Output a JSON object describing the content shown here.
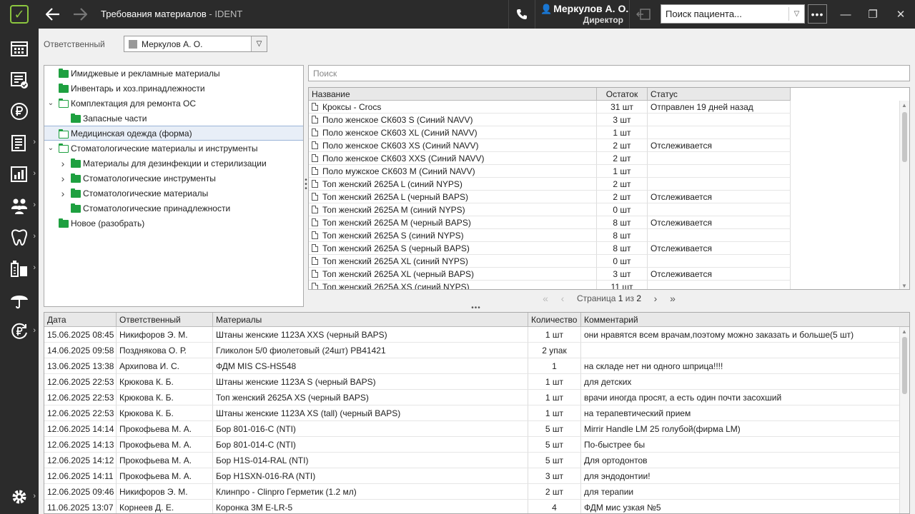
{
  "titlebar": {
    "title": "Требования материалов",
    "subtitle": " - IDENT",
    "user_name": "Меркулов А. О.",
    "user_role": "Директор",
    "patient_search_placeholder": "Поиск пациента..."
  },
  "filter": {
    "label": "Ответственный",
    "value": "Меркулов А. О."
  },
  "tree": [
    {
      "label": "Имиджевые и рекламные материалы",
      "level": 0,
      "expander": "",
      "folder": "closed",
      "selected": false
    },
    {
      "label": "Инвентарь и хоз.принадлежности",
      "level": 0,
      "expander": "",
      "folder": "closed",
      "selected": false
    },
    {
      "label": "Комплектация для ремонта ОС",
      "level": 0,
      "expander": "down",
      "folder": "open",
      "selected": false
    },
    {
      "label": "Запасные части",
      "level": 1,
      "expander": "",
      "folder": "closed",
      "selected": false
    },
    {
      "label": "Медицинская одежда (форма)",
      "level": 0,
      "expander": "",
      "folder": "open",
      "selected": true
    },
    {
      "label": "Стоматологические материалы и инструменты",
      "level": 0,
      "expander": "down",
      "folder": "open",
      "selected": false
    },
    {
      "label": "Материалы для дезинфекции и стерилизации",
      "level": 1,
      "expander": "right",
      "folder": "closed",
      "selected": false
    },
    {
      "label": "Стоматологические инструменты",
      "level": 1,
      "expander": "right",
      "folder": "closed",
      "selected": false
    },
    {
      "label": "Стоматологические материалы",
      "level": 1,
      "expander": "right",
      "folder": "closed",
      "selected": false
    },
    {
      "label": "Стоматологические принадлежности",
      "level": 1,
      "expander": "",
      "folder": "closed",
      "selected": false
    },
    {
      "label": "Новое (разобрать)",
      "level": 0,
      "expander": "",
      "folder": "closed",
      "selected": false
    }
  ],
  "materials": {
    "search_placeholder": "Поиск",
    "columns": {
      "name": "Название",
      "stock": "Остаток",
      "status": "Статус"
    },
    "rows": [
      {
        "name": "Кроксы  -  Crocs",
        "stock": "31 шт",
        "status": "Отправлен 19 дней назад"
      },
      {
        "name": "Поло женское СК603 S (Синий NAVV)",
        "stock": "3 шт",
        "status": ""
      },
      {
        "name": "Поло женское СК603 XL (Синий NAVV)",
        "stock": "1 шт",
        "status": ""
      },
      {
        "name": "Поло женское СК603 XS (Синий NAVV)",
        "stock": "2 шт",
        "status": "Отслеживается"
      },
      {
        "name": "Поло женское СК603 XXS (Синий NAVV)",
        "stock": "2 шт",
        "status": ""
      },
      {
        "name": "Поло мужское СК603 M (Синий NAVV)",
        "stock": "1 шт",
        "status": ""
      },
      {
        "name": "Топ женский 2625A L (синий NYPS)",
        "stock": "2 шт",
        "status": ""
      },
      {
        "name": "Топ женский 2625A L (черный BAPS)",
        "stock": "2 шт",
        "status": "Отслеживается"
      },
      {
        "name": "Топ женский 2625A M (синий NYPS)",
        "stock": "0 шт",
        "status": ""
      },
      {
        "name": "Топ женский 2625A M (черный BAPS)",
        "stock": "8 шт",
        "status": "Отслеживается"
      },
      {
        "name": "Топ женский 2625A S (синий NYPS)",
        "stock": "8 шт",
        "status": ""
      },
      {
        "name": "Топ женский 2625A S (черный BAPS)",
        "stock": "8 шт",
        "status": "Отслеживается"
      },
      {
        "name": "Топ женский 2625A XL (синий NYPS)",
        "stock": "0 шт",
        "status": ""
      },
      {
        "name": "Топ женский 2625A XL (черный BAPS)",
        "stock": "3 шт",
        "status": "Отслеживается"
      },
      {
        "name": "Топ женский 2625A XS (синий NYPS)",
        "stock": "11 шт",
        "status": ""
      }
    ],
    "pager": {
      "prefix": "Страница",
      "current": "1",
      "sep": "из",
      "total": "2"
    }
  },
  "requests": {
    "columns": {
      "date": "Дата",
      "resp": "Ответственный",
      "material": "Материалы",
      "qty": "Количество",
      "comment": "Комментарий"
    },
    "rows": [
      {
        "date": "15.06.2025 08:45",
        "resp": "Никифоров Э. М.",
        "material": "Штаны женские 1123A XXS (черный BAPS)",
        "qty": "1 шт",
        "comment": "они нравятся всем врачам,поэтому можно заказать и больше(5 шт)"
      },
      {
        "date": "14.06.2025 09:58",
        "resp": "Позднякова О. Р.",
        "material": "Гликолон 5/0 фиолетовый (24шт) PB41421",
        "qty": "2 упак",
        "comment": ""
      },
      {
        "date": "13.06.2025 13:38",
        "resp": "Архипова И. С.",
        "material": "ФДМ MIS CS-HS548",
        "qty": "1",
        "comment": "на складе нет ни одного шприца!!!!"
      },
      {
        "date": "12.06.2025 22:53",
        "resp": "Крюкова К. Б.",
        "material": "Штаны женские 1123A S (черный BAPS)",
        "qty": "1 шт",
        "comment": "для детских"
      },
      {
        "date": "12.06.2025 22:53",
        "resp": "Крюкова К. Б.",
        "material": "Топ женский 2625A XS (черный BAPS)",
        "qty": "1 шт",
        "comment": "врачи иногда просят, а есть один почти засохший"
      },
      {
        "date": "12.06.2025 22:53",
        "resp": "Крюкова К. Б.",
        "material": "Штаны женские 1123A XS (tall) (черный BAPS)",
        "qty": "1 шт",
        "comment": "на терапевтический прием"
      },
      {
        "date": "12.06.2025 14:14",
        "resp": "Прокофьева М. А.",
        "material": "Бор 801-016-C (NTI)",
        "qty": "5 шт",
        "comment": "Mirrir Handle LM 25 голубой(фирма LM)"
      },
      {
        "date": "12.06.2025 14:13",
        "resp": "Прокофьева М. А.",
        "material": "Бор 801-014-C (NTI)",
        "qty": "5 шт",
        "comment": "По-быстрее бы"
      },
      {
        "date": "12.06.2025 14:12",
        "resp": "Прокофьева М. А.",
        "material": "Бор H1S-014-RAL (NTI)",
        "qty": "5 шт",
        "comment": "Для ортодонтов"
      },
      {
        "date": "12.06.2025 14:11",
        "resp": "Прокофьева М. А.",
        "material": "Бор H1SXN-016-RA (NTI)",
        "qty": "3 шт",
        "comment": "для эндодонтии!"
      },
      {
        "date": "12.06.2025 09:46",
        "resp": "Никифоров Э. М.",
        "material": "Клинпро  -  Clinpro  Герметик (1.2 мл)",
        "qty": "2 шт",
        "comment": "для терапии"
      },
      {
        "date": "11.06.2025 13:07",
        "resp": "Корнеев Д. Е.",
        "material": "Коронка 3M E-LR-5",
        "qty": "4",
        "comment": "ФДМ мис узкая №5"
      }
    ]
  }
}
